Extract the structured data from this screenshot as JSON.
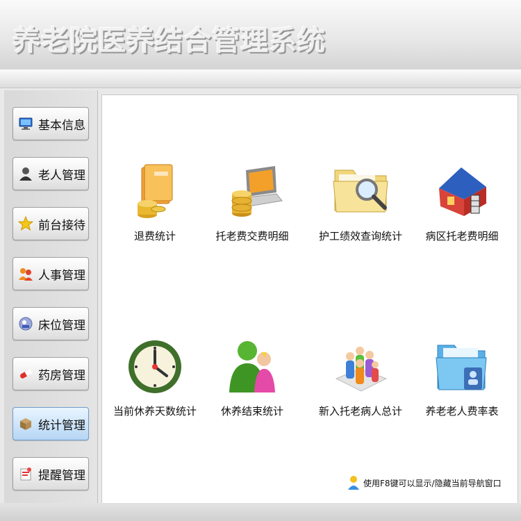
{
  "header": {
    "title": "养老院医养结合管理系统"
  },
  "sidebar": {
    "items": [
      {
        "label": "基本信息",
        "icon": "monitor-icon"
      },
      {
        "label": "老人管理",
        "icon": "person-icon"
      },
      {
        "label": "前台接待",
        "icon": "star-icon"
      },
      {
        "label": "人事管理",
        "icon": "people-icon"
      },
      {
        "label": "床位管理",
        "icon": "bed-icon"
      },
      {
        "label": "药房管理",
        "icon": "pill-icon"
      },
      {
        "label": "统计管理",
        "icon": "box-icon",
        "active": true
      },
      {
        "label": "提醒管理",
        "icon": "reminder-icon"
      }
    ]
  },
  "main": {
    "tiles": [
      {
        "label": "退费统计",
        "icon": "folder-coins-icon"
      },
      {
        "label": "托老费交费明细",
        "icon": "laptop-coins-icon"
      },
      {
        "label": "护工绩效查询统计",
        "icon": "folder-search-icon"
      },
      {
        "label": "病区托老费明细",
        "icon": "house-icon"
      },
      {
        "label": "当前休养天数统计",
        "icon": "clock-icon"
      },
      {
        "label": "休养结束统计",
        "icon": "users-icon"
      },
      {
        "label": "新入托老病人总计",
        "icon": "people-group-icon"
      },
      {
        "label": "养老老人费率表",
        "icon": "folder-blue-icon"
      }
    ],
    "hint": "使用F8键可以显示/隐藏当前导航窗口"
  }
}
